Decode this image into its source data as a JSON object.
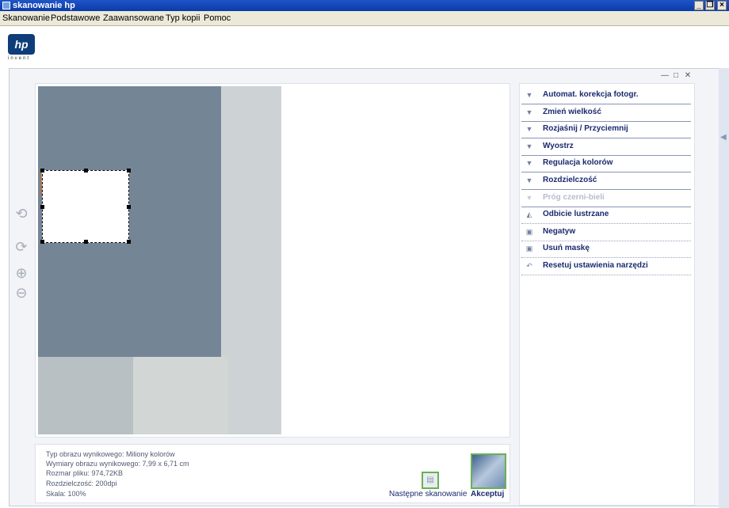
{
  "window": {
    "title": "skanowanie hp",
    "controls": {
      "minimize": "_",
      "restore": "❐",
      "close": "×"
    }
  },
  "menu": [
    "Skanowanie",
    "Podstawowe",
    "Zaawansowane",
    "Typ kopii",
    "Pomoc"
  ],
  "brand": {
    "logo": "hp",
    "tagline": "invent"
  },
  "panel_controls": {
    "minimize": "—",
    "maximize": "□",
    "close": "✕"
  },
  "tools": [
    {
      "name": "rotate-icon",
      "glyph": "⟲"
    },
    {
      "name": "crop-rotate-icon",
      "glyph": "⟳"
    },
    {
      "name": "zoom-in-icon",
      "glyph": "⊕"
    },
    {
      "name": "zoom-out-icon",
      "glyph": "⊖"
    }
  ],
  "panel": {
    "items": [
      {
        "label": "Automat. korekcja fotogr.",
        "icon": "chevron-down-icon",
        "glyph": "▼"
      },
      {
        "label": "Zmień wielkość",
        "icon": "chevron-down-icon",
        "glyph": "▼"
      },
      {
        "label": "Rozjaśnij / Przyciemnij",
        "icon": "chevron-down-icon",
        "glyph": "▼"
      },
      {
        "label": "Wyostrz",
        "icon": "chevron-down-icon",
        "glyph": "▼"
      },
      {
        "label": "Regulacja kolorów",
        "icon": "chevron-down-icon",
        "glyph": "▼"
      },
      {
        "label": "Rozdzielczość",
        "icon": "chevron-down-icon",
        "glyph": "▼"
      },
      {
        "label": "Próg czerni-bieli",
        "icon": "chevron-down-icon",
        "glyph": "▼",
        "disabled": true
      },
      {
        "label": "Odbicie lustrzane",
        "icon": "mirror-icon",
        "glyph": "◭"
      },
      {
        "label": "Negatyw",
        "icon": "negative-icon",
        "glyph": "▣"
      },
      {
        "label": "Usuń maskę",
        "icon": "mask-icon",
        "glyph": "▣"
      },
      {
        "label": "Resetuj ustawienia narzędzi",
        "icon": "reset-icon",
        "glyph": "↶"
      }
    ]
  },
  "info": {
    "type": "Typ obrazu wynikowego: Miliony kolorów",
    "dimensions": "Wymiary obrazu wynikowego: 7,99 x 6,71 cm",
    "file_size": "Rozmar pliku: 974,72KB",
    "resolution": "Rozdzielczość:  200dpi",
    "scale": "Skala: 100%"
  },
  "actions": {
    "next_scan": "Następne skanowanie",
    "accept": "Akceptuj"
  }
}
